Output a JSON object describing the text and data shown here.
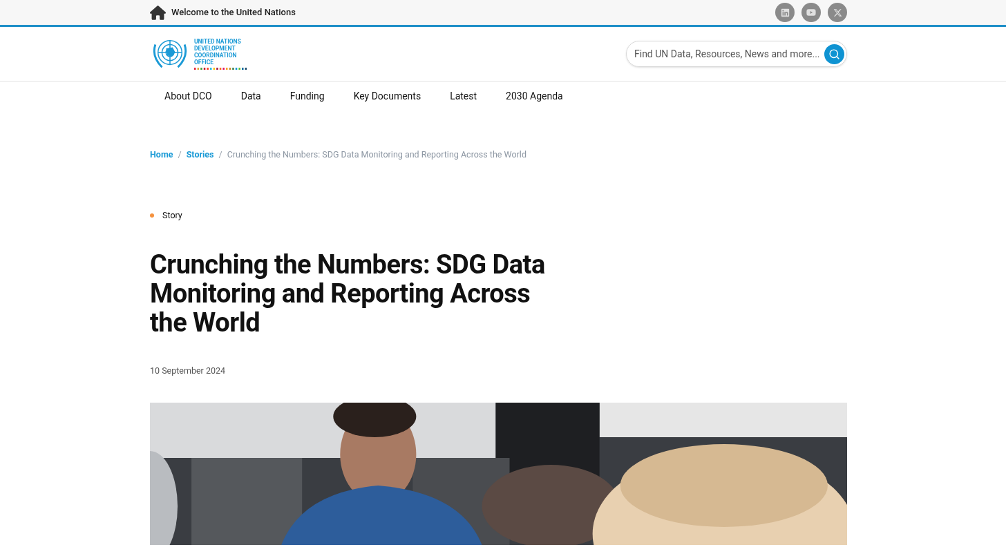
{
  "top_bar": {
    "welcome": "Welcome to the United Nations"
  },
  "logo": {
    "lines": [
      "UNITED NATIONS",
      "DEVELOPMENT",
      "COORDINATION",
      "OFFICE"
    ]
  },
  "search": {
    "placeholder": "Find UN Data, Resources, News and more..."
  },
  "nav": [
    "About DCO",
    "Data",
    "Funding",
    "Key Documents",
    "Latest",
    "2030 Agenda"
  ],
  "breadcrumb": [
    {
      "label": "Home",
      "kind": "link"
    },
    {
      "label": "/",
      "kind": "separator"
    },
    {
      "label": "Stories",
      "kind": "link"
    },
    {
      "label": "/",
      "kind": "separator"
    },
    {
      "label": "Crunching the Numbers: SDG Data Monitoring and Reporting Across the World",
      "kind": "current"
    }
  ],
  "article": {
    "category": {
      "label": "Story",
      "color": "#f5923e"
    },
    "title": "Crunching the Numbers: SDG Data Monitoring and Reporting Across the World",
    "date": "10 September 2024"
  }
}
